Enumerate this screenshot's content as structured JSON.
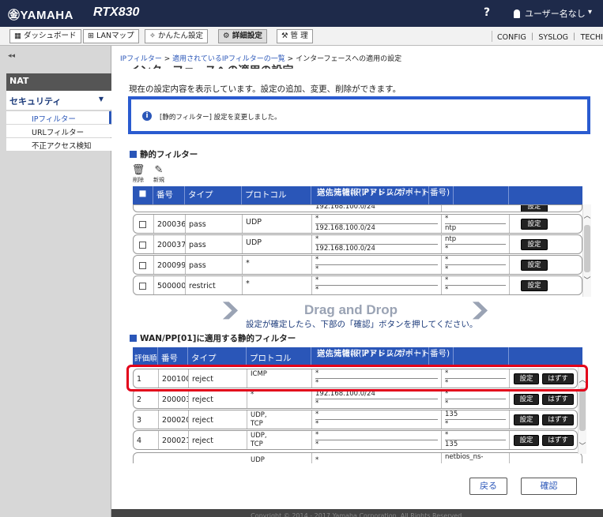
{
  "header": {
    "logo": "㊎YAMAHA",
    "model": "RTX830",
    "help": "?",
    "user": "ユーザー名なし",
    "caret": "▾"
  },
  "nav": {
    "items": [
      "ダッシュボード",
      "LANマップ",
      "かんたん設定",
      "詳細設定",
      "管 理"
    ],
    "active": "詳細設定",
    "right_links": "CONFIG ｜ SYSLOG ｜ TECHINFO"
  },
  "sidebar": {
    "collapse": "◂◂",
    "nat": "NAT",
    "security": "セキュリティ",
    "security_caret": "▼",
    "items": [
      "IPフィルター",
      "URLフィルター",
      "不正アクセス検知"
    ],
    "active": "IPフィルター"
  },
  "breadcrumb": {
    "part1": "IPフィルター",
    "sep1": " > ",
    "part2": "適用されているIPフィルターの一覧",
    "sep2": " > ",
    "part3": "インターフェースへの適用の設定"
  },
  "page_title": "インターフェースへの適用の設定",
  "description": "現在の設定内容を表示しています。設定の追加、変更、削除ができます。",
  "notice": {
    "icon": "i",
    "text": "[静的フィルター] 設定を変更しました。"
  },
  "static_section": {
    "title": "静的フィルター",
    "tools": [
      {
        "icon": "🗑",
        "label": "削除"
      },
      {
        "icon": "✎",
        "label": "新規"
      }
    ],
    "headers": {
      "check": "■",
      "number": "番号",
      "type": "タイプ",
      "protocol": "プロトコル",
      "src": "送信元情報(IPアドレス/ポート番号)",
      "dst": "宛先情報(IPアドレス/ポート)"
    },
    "rows": [
      {
        "number": "200036",
        "type": "pass",
        "protocol": "UDP",
        "src1": "*",
        "src2": "192.168.100.0/24",
        "dst1": "*",
        "dst2": "ntp",
        "btn": "設定"
      },
      {
        "number": "200037",
        "type": "pass",
        "protocol": "UDP",
        "src1": "*",
        "src2": "192.168.100.0/24",
        "dst1": "ntp",
        "dst2": "*",
        "btn": "設定"
      },
      {
        "number": "200099",
        "type": "pass",
        "protocol": "*",
        "src1": "*",
        "src2": "*",
        "dst1": "*",
        "dst2": "*",
        "btn": "設定"
      },
      {
        "number": "500000",
        "type": "restrict",
        "protocol": "*",
        "src1": "*",
        "src2": "*",
        "dst1": "*",
        "dst2": "*",
        "btn": "設定"
      }
    ],
    "partial_row": {
      "src": "192.168.100.0/24",
      "btn": "設定"
    }
  },
  "dnd": {
    "text": "Drag and Drop",
    "note": "設定が確定したら、下部の「確認」ボタンを押してください。",
    "chevron": "❯"
  },
  "wan_section": {
    "title": "WAN/PP[01]に適用する静的フィルター",
    "headers": {
      "order": "評価順",
      "number": "番号",
      "type": "タイプ",
      "protocol": "プロトコル",
      "src": "送信元情報(IPアドレス/ポート番号)",
      "dst": "宛先情報(IPアドレス/ポート)"
    },
    "rows": [
      {
        "order": "1",
        "number": "200100",
        "type": "reject",
        "protocol": "ICMP",
        "protocol2": "",
        "src1": "*",
        "src2": "*",
        "dst1": "*",
        "dst2": "*",
        "btn1": "設定",
        "btn2": "はずす"
      },
      {
        "order": "2",
        "number": "200003",
        "type": "reject",
        "protocol": "*",
        "protocol2": "",
        "src1": "192.168.100.0/24",
        "src2": "*",
        "dst1": "*",
        "dst2": "*",
        "btn1": "設定",
        "btn2": "はずす"
      },
      {
        "order": "3",
        "number": "200020",
        "type": "reject",
        "protocol": "UDP,",
        "protocol2": "TCP",
        "src1": "*",
        "src2": "*",
        "dst1": "135",
        "dst2": "*",
        "btn1": "設定",
        "btn2": "はずす"
      },
      {
        "order": "4",
        "number": "200021",
        "type": "reject",
        "protocol": "UDP,",
        "protocol2": "TCP",
        "src1": "*",
        "src2": "*",
        "dst1": "*",
        "dst2": "135",
        "btn1": "設定",
        "btn2": "はずす"
      }
    ],
    "partial_row": {
      "protocol": "UDP",
      "src": "*",
      "dst": "netbios_ns-"
    }
  },
  "buttons": {
    "back": "戻る",
    "confirm": "確認"
  },
  "footer": "Copyright © 2014 - 2017 Yamaha Corporation. All Rights Reserved.",
  "scroll": {
    "up": "︿",
    "down": "﹀"
  }
}
